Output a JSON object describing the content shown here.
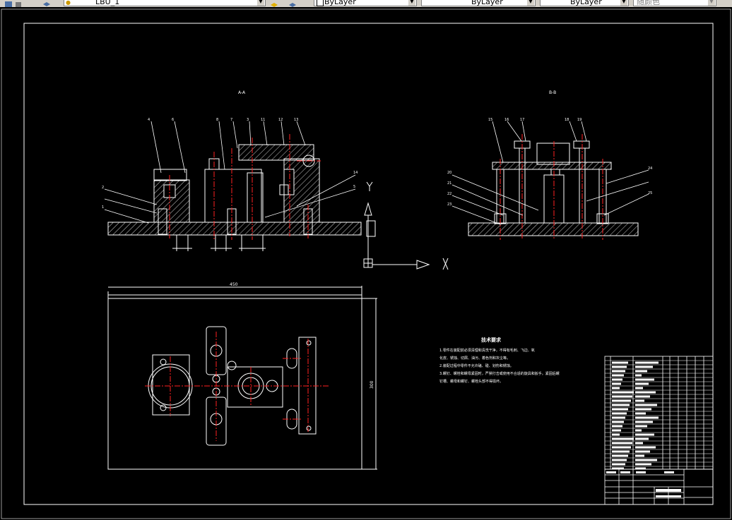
{
  "toolbar": {
    "layer_name": "LBU_1",
    "color_control": "ByLayer",
    "linetype_control": "ByLayer",
    "lineweight_control": "ByLayer",
    "plotstyle_control": "随颜色"
  },
  "drawing": {
    "section_label_a": "A-A",
    "section_label_b": "B-B",
    "callouts_front": [
      "4",
      "6",
      "8",
      "7",
      "3",
      "11",
      "12",
      "13",
      "14",
      "5",
      "2",
      "1"
    ],
    "callouts_side": [
      "15",
      "16",
      "17",
      "18",
      "19",
      "20",
      "21",
      "22",
      "23",
      "24",
      "25"
    ],
    "dim_width": "450",
    "dim_height": "300",
    "tech_title": "技术要求",
    "tech_lines": [
      "1.零件在装配前必须清理和清洗干净，不得有毛刺、飞边、氧",
      "化皮、锈蚀、切屑、油污、着色剂和灰尘等。",
      "2.装配过程中零件不允许磕、碰、划伤和锈蚀。",
      "3.螺钉、螺栓和螺母紧固时，严禁打击或使用不合适的旋具和扳手。紧固后螺",
      "钉槽、螺母和螺钉、螺栓头部不得损坏。"
    ],
    "ucs": {
      "x_label": "X",
      "y_label": "Y"
    }
  },
  "colors": {
    "outline": "#ffffff",
    "center": "#ff2020",
    "ucs": "#ffffff",
    "toolbar": "#d4d0c8"
  }
}
